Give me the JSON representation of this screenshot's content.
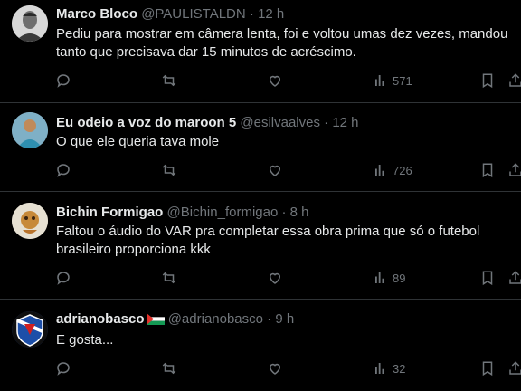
{
  "tweets": [
    {
      "name": "Marco Bloco",
      "handle": "@PAULISTALDN",
      "dot": "·",
      "time": "12 h",
      "text": "Pediu para mostrar em câmera lenta, foi e voltou umas dez vezes, mandou tanto que precisava dar 15 minutos de acréscimo.",
      "views": "571",
      "icons": [
        "reply-icon",
        "retweet-icon",
        "like-icon",
        "views-icon",
        "bookmark-icon",
        "share-icon"
      ]
    },
    {
      "name": "Eu odeio a voz do maroon 5",
      "handle": "@esilvaalves",
      "dot": "·",
      "time": "12 h",
      "text": "O que ele queria tava mole",
      "views": "726",
      "icons": [
        "reply-icon",
        "retweet-icon",
        "like-icon",
        "views-icon",
        "bookmark-icon",
        "share-icon"
      ]
    },
    {
      "name": "Bichin Formigao",
      "handle": "@Bichin_formigao",
      "dot": "·",
      "time": "8 h",
      "text": "Faltou o áudio do VAR pra completar essa obra prima que só o futebol brasileiro proporciona kkk",
      "views": "89",
      "icons": [
        "reply-icon",
        "retweet-icon",
        "like-icon",
        "views-icon",
        "bookmark-icon",
        "share-icon"
      ]
    },
    {
      "name": "adrianobasco",
      "name_emoji": "palestine-flag-icon",
      "handle": "@adrianobasco",
      "dot": "·",
      "time": "9 h",
      "text": "E gosta...",
      "views": "32",
      "icons": [
        "reply-icon",
        "retweet-icon",
        "like-icon",
        "views-icon",
        "bookmark-icon",
        "share-icon"
      ]
    }
  ],
  "colors": {
    "background": "#000000",
    "text": "#e7e9ea",
    "secondary": "#71767b",
    "divider": "#2f3336"
  }
}
